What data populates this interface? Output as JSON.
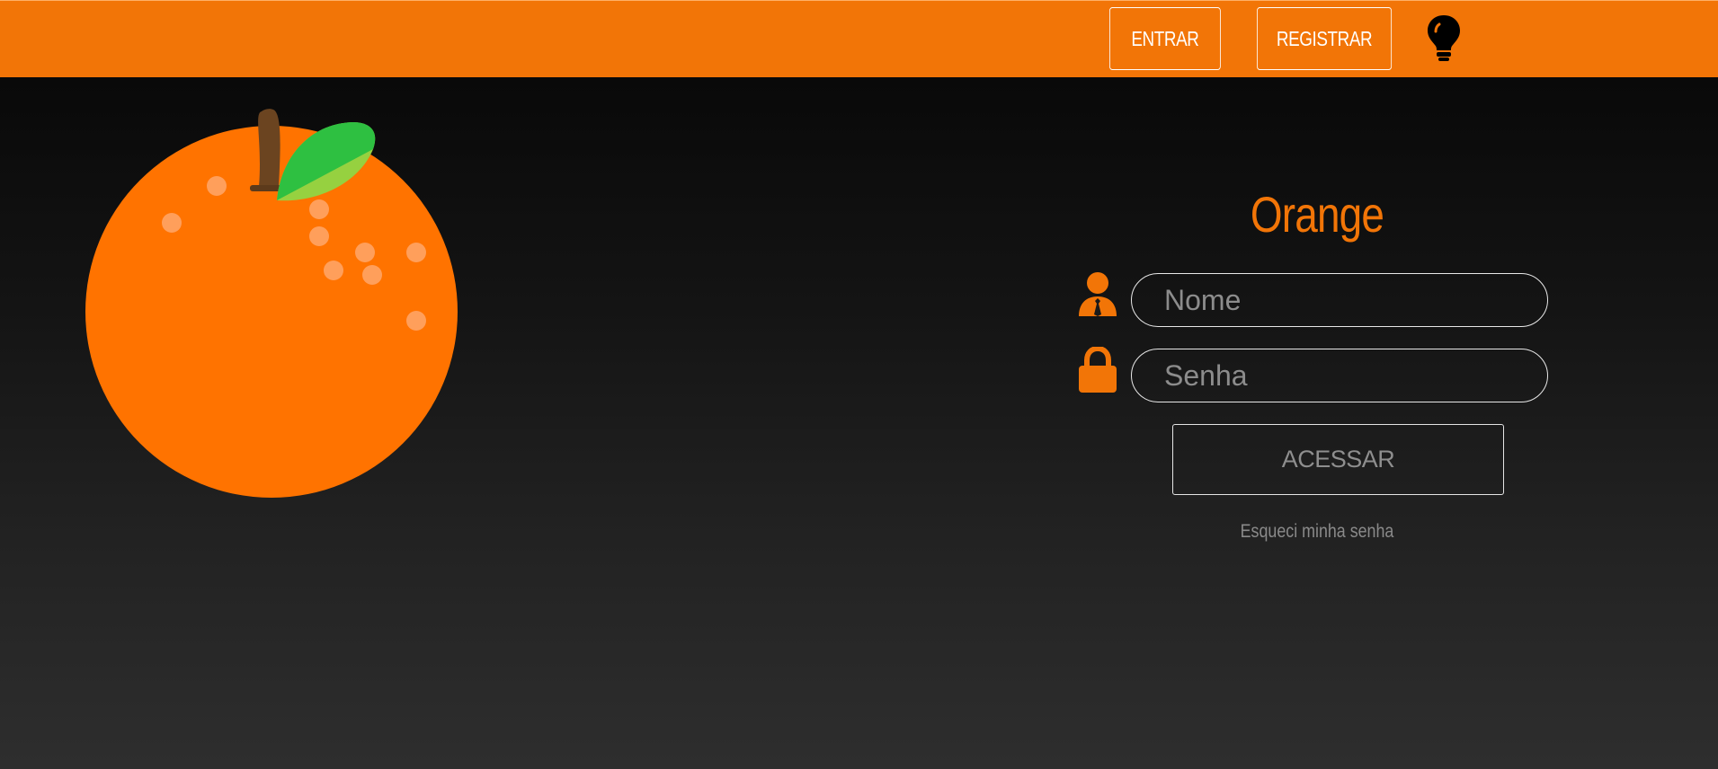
{
  "header": {
    "login_label": "ENTRAR",
    "register_label": "REGISTRAR",
    "theme_icon": "lightbulb-icon"
  },
  "brand": {
    "title": "Orange",
    "logo_icon": "orange-fruit-icon"
  },
  "login_form": {
    "name_placeholder": "Nome",
    "name_icon": "user-tie-icon",
    "password_placeholder": "Senha",
    "password_icon": "lock-icon",
    "submit_label": "ACESSAR",
    "forgot_label": "Esqueci minha senha"
  },
  "colors": {
    "accent": "#f27507",
    "orange_fruit": "#ff7300",
    "leaf_dark": "#2ec041",
    "leaf_light": "#96d140",
    "stem": "#6b4420",
    "background_top": "#050505",
    "background_bottom": "#2e2e2e"
  }
}
